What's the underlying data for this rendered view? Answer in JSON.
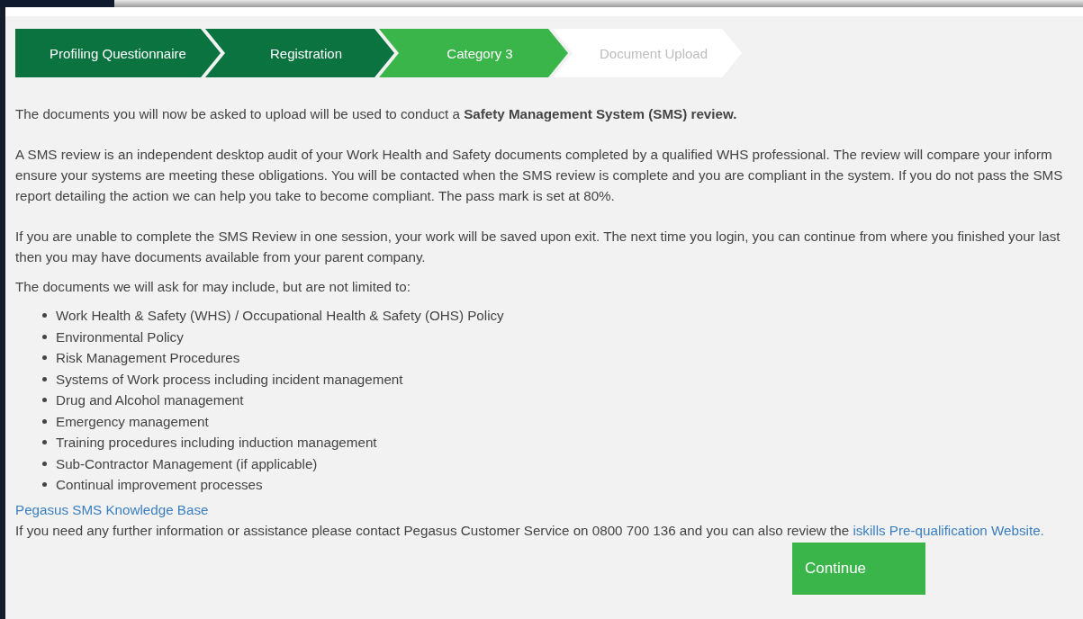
{
  "steps": [
    {
      "label": "Profiling Questionnaire",
      "kind": "done"
    },
    {
      "label": "Registration",
      "kind": "done"
    },
    {
      "label": "Category 3",
      "kind": "current"
    },
    {
      "label": "Document Upload",
      "kind": "pending"
    }
  ],
  "intro": "The documents you will now be asked to upload will be used to conduct a **Safety Management System (SMS) review.**",
  "paragraphs": [
    [
      "A SMS review is an independent desktop audit of your Work Health and Safety documents completed by a qualified WHS professional. The review will compare your inform",
      "ensure your systems are meeting these obligations. You will be contacted when the SMS review is complete and you are compliant in the system. If you do not pass the SMS",
      "report detailing the action we can help you take to become compliant. The pass mark is set at 80%."
    ],
    [
      "If you are unable to complete the SMS Review in one session, your work will be saved upon exit. The next time you login, you can continue from where you finished your last",
      "then you may have documents available from your parent company."
    ]
  ],
  "list_intro": "The documents we will ask for may include, but are not limited to:",
  "documents": [
    "Work Health & Safety (WHS) / Occupational Health & Safety (OHS) Policy",
    "Environmental Policy",
    "Risk Management Procedures",
    "Systems of Work process including incident management",
    "Drug and Alcohol management",
    "Emergency management",
    "Training procedures including induction management",
    "Sub-Contractor Management (if applicable)",
    "Continual improvement processes"
  ],
  "knowledge_link": "Pegasus SMS Knowledge Base",
  "contact": {
    "text": "If you need any further information or assistance please contact Pegasus Customer Service on 0800 700 136 and you can also review the",
    "link": "iskills Pre-qualification Website."
  },
  "continue_button": "Continue"
}
